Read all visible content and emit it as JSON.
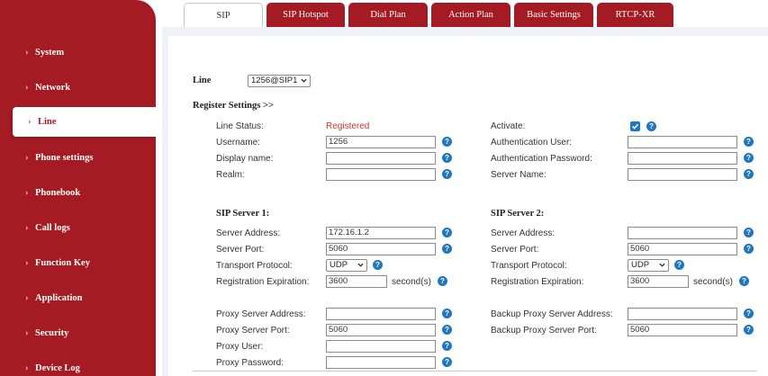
{
  "sidebar": {
    "items": [
      {
        "label": "System",
        "active": false
      },
      {
        "label": "Network",
        "active": false
      },
      {
        "label": "Line",
        "active": true
      },
      {
        "label": "Phone settings",
        "active": false
      },
      {
        "label": "Phonebook",
        "active": false
      },
      {
        "label": "Call logs",
        "active": false
      },
      {
        "label": "Function Key",
        "active": false
      },
      {
        "label": "Application",
        "active": false
      },
      {
        "label": "Security",
        "active": false
      },
      {
        "label": "Device Log",
        "active": false
      }
    ]
  },
  "tabs": [
    {
      "label": "SIP",
      "active": true
    },
    {
      "label": "SIP Hotspot"
    },
    {
      "label": "Dial Plan"
    },
    {
      "label": "Action Plan"
    },
    {
      "label": "Basic Settings"
    },
    {
      "label": "RTCP-XR"
    }
  ],
  "line": {
    "label": "Line",
    "selected": "1256@SIP1"
  },
  "register": {
    "heading": "Register Settings >>",
    "line_status_label": "Line Status:",
    "line_status_value": "Registered",
    "username_label": "Username:",
    "username_value": "1256",
    "display_name_label": "Display name:",
    "display_name_value": "",
    "realm_label": "Realm:",
    "realm_value": "",
    "activate_label": "Activate:",
    "activate_checked": true,
    "auth_user_label": "Authentication User:",
    "auth_user_value": "",
    "auth_password_label": "Authentication Password:",
    "auth_password_value": "",
    "server_name_label": "Server Name:",
    "server_name_value": ""
  },
  "sip_server_1": {
    "heading": "SIP Server 1:",
    "address_label": "Server Address:",
    "address_value": "172.16.1.2",
    "port_label": "Server Port:",
    "port_value": "5060",
    "transport_label": "Transport Protocol:",
    "transport_value": "UDP",
    "expiration_label": "Registration Expiration:",
    "expiration_value": "3600",
    "expiration_unit": "second(s)"
  },
  "sip_server_2": {
    "heading": "SIP Server 2:",
    "address_label": "Server Address:",
    "address_value": "",
    "port_label": "Server Port:",
    "port_value": "5060",
    "transport_label": "Transport Protocol:",
    "transport_value": "UDP",
    "expiration_label": "Registration Expiration:",
    "expiration_value": "3600",
    "expiration_unit": "second(s)"
  },
  "proxy": {
    "address_label": "Proxy Server Address:",
    "address_value": "",
    "port_label": "Proxy Server Port:",
    "port_value": "5060",
    "user_label": "Proxy User:",
    "user_value": "",
    "password_label": "Proxy Password:",
    "password_value": "",
    "backup_address_label": "Backup Proxy Server Address:",
    "backup_address_value": "",
    "backup_port_label": "Backup Proxy Server Port:",
    "backup_port_value": "5060"
  },
  "help_glyph": "?",
  "icons": {
    "help": "help-icon",
    "caret": "chevron-down-icon",
    "chevron": "chevron-right-icon"
  },
  "colors": {
    "brand": "#a51b23",
    "help": "#1f76c2",
    "status": "#d0342c",
    "panel": "#eef2f6"
  }
}
